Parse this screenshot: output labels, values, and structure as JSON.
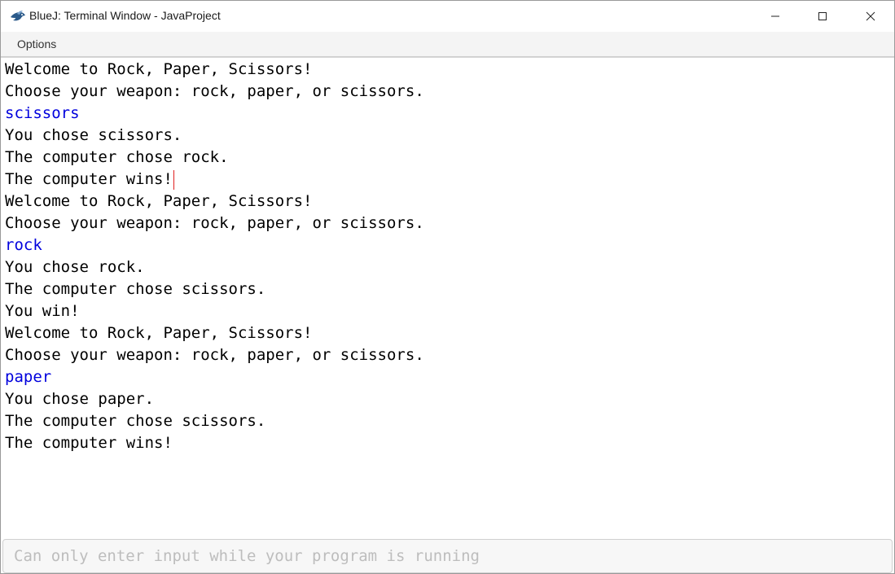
{
  "window": {
    "title": "BlueJ: Terminal Window - JavaProject",
    "controls": {
      "minimize_icon": "minimize-icon",
      "maximize_icon": "maximize-icon",
      "close_icon": "close-icon"
    }
  },
  "menubar": {
    "options_label": "Options"
  },
  "terminal": {
    "lines": [
      {
        "text": "Welcome to Rock, Paper, Scissors!",
        "kind": "output"
      },
      {
        "text": "Choose your weapon: rock, paper, or scissors.",
        "kind": "output"
      },
      {
        "text": "scissors",
        "kind": "input"
      },
      {
        "text": "You chose scissors.",
        "kind": "output"
      },
      {
        "text": "The computer chose rock.",
        "kind": "output"
      },
      {
        "text": "The computer wins!",
        "kind": "output"
      },
      {
        "text": "Welcome to Rock, Paper, Scissors!",
        "kind": "output"
      },
      {
        "text": "Choose your weapon: rock, paper, or scissors.",
        "kind": "output"
      },
      {
        "text": "rock",
        "kind": "input"
      },
      {
        "text": "You chose rock.",
        "kind": "output"
      },
      {
        "text": "The computer chose scissors.",
        "kind": "output"
      },
      {
        "text": "You win!",
        "kind": "output"
      },
      {
        "text": "Welcome to Rock, Paper, Scissors!",
        "kind": "output"
      },
      {
        "text": "Choose your weapon: rock, paper, or scissors.",
        "kind": "output"
      },
      {
        "text": "paper",
        "kind": "input"
      },
      {
        "text": "You chose paper.",
        "kind": "output"
      },
      {
        "text": "The computer chose scissors.",
        "kind": "output"
      },
      {
        "text": "The computer wins!",
        "kind": "output"
      }
    ],
    "input_color": "#0000dd",
    "output_color": "#000000",
    "caret_color": "#e02020"
  },
  "input_field": {
    "placeholder": "Can only enter input while your program is running",
    "value": ""
  }
}
